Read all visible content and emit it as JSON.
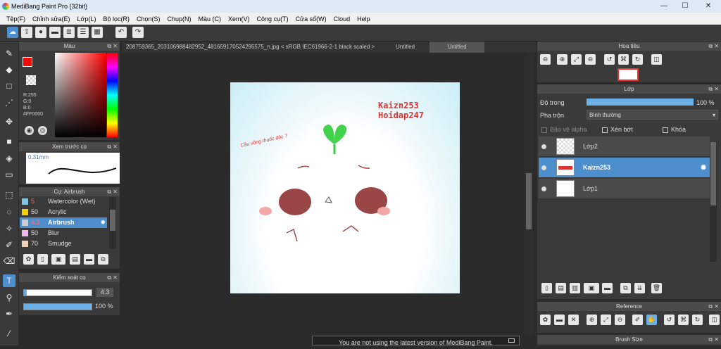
{
  "app": {
    "title": "MediBang Paint Pro (32bit)"
  },
  "window_controls": {
    "minimize": "—",
    "maximize": "☐",
    "close": "✕"
  },
  "menu": [
    "Tệp(F)",
    "Chỉnh sửa(E)",
    "Lớp(L)",
    "Bộ lọc(R)",
    "Chọn(S)",
    "Chụp(N)",
    "Màu (C)",
    "Xem(V)",
    "Công cụ(T)",
    "Cửa sổ(W)",
    "Cloud",
    "Help"
  ],
  "color_panel": {
    "title": "Màu",
    "r": "R:255",
    "g": "G:0",
    "b": "B:0",
    "hex": "#FF0000",
    "foreground": "#ff0000"
  },
  "brush_preview": {
    "title": "Xem trước cọ",
    "size": "0.31mm"
  },
  "brush_panel": {
    "title": "Cọ: Airbrush",
    "items": [
      {
        "size": "5",
        "name": "Watercolor (Wet)",
        "color": "#7ec8e3"
      },
      {
        "size": "50",
        "name": "Acrylic",
        "color": "#f2d100"
      },
      {
        "size": "4.3",
        "name": "Airbrush",
        "color": "#cccccc"
      },
      {
        "size": "50",
        "name": "Blur",
        "color": "#f5b3f0"
      },
      {
        "size": "70",
        "name": "Smudge",
        "color": "#f3d0b8"
      }
    ]
  },
  "brush_control": {
    "title": "Kiểm soát cọ",
    "size_value": "4.3",
    "opacity_value": "100 %",
    "size_fraction": 0.043,
    "opacity_fraction": 1.0
  },
  "document": {
    "tabs": [
      "208759365_203106988482952_481659170524295575_n.jpg < sRGB IEC61966-2-1 black scaled >",
      "Untitled",
      "Untitled"
    ],
    "art_text_1": "Kaizn253",
    "art_text_2": "Hoidap247",
    "art_caption": "Cầu vồng thuốc độc ?"
  },
  "navigator": {
    "title": "Hoa tiêu"
  },
  "layer_panel": {
    "title": "Lớp",
    "opacity_label": "Độ trong",
    "opacity_value": "100 %",
    "opacity_fraction": 1.0,
    "blend_label": "Pha trộn",
    "blend_value": "Bình thường",
    "protect_alpha": "Bảo vệ alpha",
    "clipping": "Xén bớt",
    "lock": "Khóa",
    "layers": [
      {
        "name": "Lớp2"
      },
      {
        "name": "Kaizn253"
      },
      {
        "name": "Lớp1"
      }
    ]
  },
  "reference_panel": {
    "title": "Reference"
  },
  "brush_size_panel": {
    "title": "Brush Size"
  },
  "notice": "You are not using the latest version of MediBang Paint."
}
